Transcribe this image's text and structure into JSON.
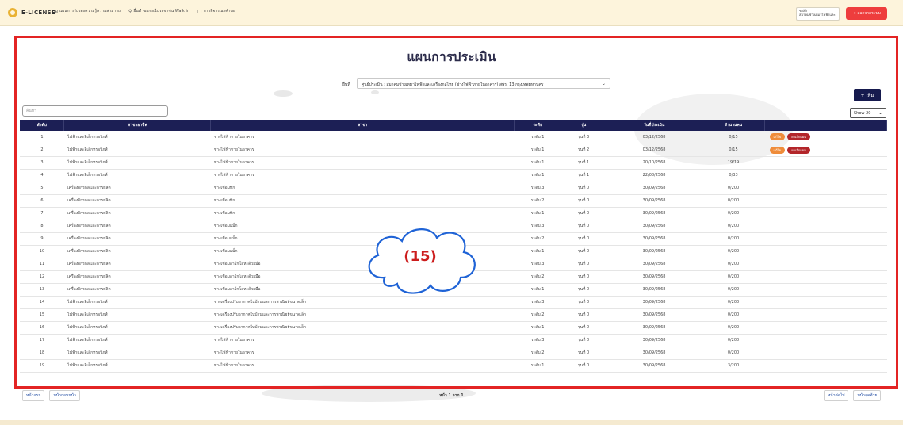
{
  "topbar": {
    "brand": "E-LICENSE",
    "nav": [
      {
        "icon": "book-icon",
        "glyph": "⊞",
        "label": "แผนการรับรองความรู้ความสามารถ"
      },
      {
        "icon": "walk-icon",
        "glyph": "⚲",
        "label": "ยื่นคำขอกรณีประชาชน Walk in"
      },
      {
        "icon": "document-icon",
        "glyph": "▢",
        "label": "การพิจารณาคำขอ"
      }
    ],
    "user_name": "ชาลิสิ",
    "user_org": "สมาคมช่างเหมาไฟฟ้าและ...",
    "logout_label": "ออกจากระบบ"
  },
  "page": {
    "title": "แผนการประเมิน",
    "filter_label": "ยื่นที่",
    "filter_value": "ศูนย์ประเมิน : สมาคมช่างเหมาไฟฟ้าและเครื่องกลไทย (ช่างไฟฟ้าภายในอาคาร) สพร. 13 กรุงเทพมหานคร",
    "add_label": "+ เพิ่ม",
    "search_placeholder": "ค้นหา",
    "show_label": "Show 20"
  },
  "table": {
    "headers": [
      "ลำดับ",
      "สาขาอาชีพ",
      "สาขา",
      "ระดับ",
      "รุ่น",
      "วันที่ประเมิน",
      "จำนวนคน",
      ""
    ],
    "edit_label": "แก้ไข",
    "delete_label": "ยกเลิกแผน",
    "rows": [
      {
        "no": "1",
        "occupation": "ไฟฟ้าและอิเล็กทรอนิกส์",
        "branch": "ช่างไฟฟ้าภายในอาคาร",
        "level": "ระดับ 1",
        "batch": "รุ่นที่ 3",
        "date": "03/12/2568",
        "count": "0/15",
        "actions": true
      },
      {
        "no": "2",
        "occupation": "ไฟฟ้าและอิเล็กทรอนิกส์",
        "branch": "ช่างไฟฟ้าภายในอาคาร",
        "level": "ระดับ 1",
        "batch": "รุ่นที่ 2",
        "date": "03/12/2568",
        "count": "0/15",
        "actions": true
      },
      {
        "no": "3",
        "occupation": "ไฟฟ้าและอิเล็กทรอนิกส์",
        "branch": "ช่างไฟฟ้าภายในอาคาร",
        "level": "ระดับ 1",
        "batch": "รุ่นที่ 1",
        "date": "20/10/2568",
        "count": "19/19",
        "actions": false
      },
      {
        "no": "4",
        "occupation": "ไฟฟ้าและอิเล็กทรอนิกส์",
        "branch": "ช่างไฟฟ้าภายในอาคาร",
        "level": "ระดับ 1",
        "batch": "รุ่นที่ 1",
        "date": "22/08/2568",
        "count": "0/33",
        "actions": false
      },
      {
        "no": "5",
        "occupation": "เครื่องจักรกลและการผลิต",
        "branch": "ช่างเชื่อมทิก",
        "level": "ระดับ 3",
        "batch": "รุ่นที่ 0",
        "date": "30/09/2568",
        "count": "0/200",
        "actions": false
      },
      {
        "no": "6",
        "occupation": "เครื่องจักรกลและการผลิต",
        "branch": "ช่างเชื่อมทิก",
        "level": "ระดับ 2",
        "batch": "รุ่นที่ 0",
        "date": "30/09/2568",
        "count": "0/200",
        "actions": false
      },
      {
        "no": "7",
        "occupation": "เครื่องจักรกลและการผลิต",
        "branch": "ช่างเชื่อมทิก",
        "level": "ระดับ 1",
        "batch": "รุ่นที่ 0",
        "date": "30/09/2568",
        "count": "0/200",
        "actions": false
      },
      {
        "no": "8",
        "occupation": "เครื่องจักรกลและการผลิต",
        "branch": "ช่างเชื่อมแม็ก",
        "level": "ระดับ 3",
        "batch": "รุ่นที่ 0",
        "date": "30/09/2568",
        "count": "0/200",
        "actions": false
      },
      {
        "no": "9",
        "occupation": "เครื่องจักรกลและการผลิต",
        "branch": "ช่างเชื่อมแม็ก",
        "level": "ระดับ 2",
        "batch": "รุ่นที่ 0",
        "date": "30/09/2568",
        "count": "0/200",
        "actions": false
      },
      {
        "no": "10",
        "occupation": "เครื่องจักรกลและการผลิต",
        "branch": "ช่างเชื่อมแม็ก",
        "level": "ระดับ 1",
        "batch": "รุ่นที่ 0",
        "date": "30/09/2568",
        "count": "0/200",
        "actions": false
      },
      {
        "no": "11",
        "occupation": "เครื่องจักรกลและการผลิต",
        "branch": "ช่างเชื่อมอาร์กโลหะด้วยมือ",
        "level": "ระดับ 3",
        "batch": "รุ่นที่ 0",
        "date": "30/09/2568",
        "count": "0/200",
        "actions": false
      },
      {
        "no": "12",
        "occupation": "เครื่องจักรกลและการผลิต",
        "branch": "ช่างเชื่อมอาร์กโลหะด้วยมือ",
        "level": "ระดับ 2",
        "batch": "รุ่นที่ 0",
        "date": "30/09/2568",
        "count": "0/200",
        "actions": false
      },
      {
        "no": "13",
        "occupation": "เครื่องจักรกลและการผลิต",
        "branch": "ช่างเชื่อมอาร์กโลหะด้วยมือ",
        "level": "ระดับ 1",
        "batch": "รุ่นที่ 0",
        "date": "30/09/2568",
        "count": "0/200",
        "actions": false
      },
      {
        "no": "14",
        "occupation": "ไฟฟ้าและอิเล็กทรอนิกส์",
        "branch": "ช่างเครื่องปรับอากาศในบ้านและการพาณิชย์ขนาดเล็ก",
        "level": "ระดับ 3",
        "batch": "รุ่นที่ 0",
        "date": "30/09/2568",
        "count": "0/200",
        "actions": false
      },
      {
        "no": "15",
        "occupation": "ไฟฟ้าและอิเล็กทรอนิกส์",
        "branch": "ช่างเครื่องปรับอากาศในบ้านและการพาณิชย์ขนาดเล็ก",
        "level": "ระดับ 2",
        "batch": "รุ่นที่ 0",
        "date": "30/09/2568",
        "count": "0/200",
        "actions": false
      },
      {
        "no": "16",
        "occupation": "ไฟฟ้าและอิเล็กทรอนิกส์",
        "branch": "ช่างเครื่องปรับอากาศในบ้านและการพาณิชย์ขนาดเล็ก",
        "level": "ระดับ 1",
        "batch": "รุ่นที่ 0",
        "date": "30/09/2568",
        "count": "0/200",
        "actions": false
      },
      {
        "no": "17",
        "occupation": "ไฟฟ้าและอิเล็กทรอนิกส์",
        "branch": "ช่างไฟฟ้าภายในอาคาร",
        "level": "ระดับ 3",
        "batch": "รุ่นที่ 0",
        "date": "30/09/2568",
        "count": "0/200",
        "actions": false
      },
      {
        "no": "18",
        "occupation": "ไฟฟ้าและอิเล็กทรอนิกส์",
        "branch": "ช่างไฟฟ้าภายในอาคาร",
        "level": "ระดับ 2",
        "batch": "รุ่นที่ 0",
        "date": "30/09/2568",
        "count": "0/200",
        "actions": false
      },
      {
        "no": "19",
        "occupation": "ไฟฟ้าและอิเล็กทรอนิกส์",
        "branch": "ช่างไฟฟ้าภายในอาคาร",
        "level": "ระดับ 1",
        "batch": "รุ่นที่ 0",
        "date": "30/09/2568",
        "count": "3/200",
        "actions": false
      }
    ]
  },
  "pager": {
    "first": "หน้าแรก",
    "prev": "หน้าก่อนหน้า",
    "info": "หน้า 1 จาก 1",
    "next": "หน้าต่อไป",
    "last": "หน้าสุดท้าย"
  },
  "annotation": {
    "label": "(15)",
    "color": "#cc1c1c"
  },
  "colors": {
    "header_bg": "#1c1f55",
    "logout": "#ee3d3d",
    "edit": "#ef8c3a",
    "delete": "#b3262a",
    "frame": "#e32424"
  }
}
